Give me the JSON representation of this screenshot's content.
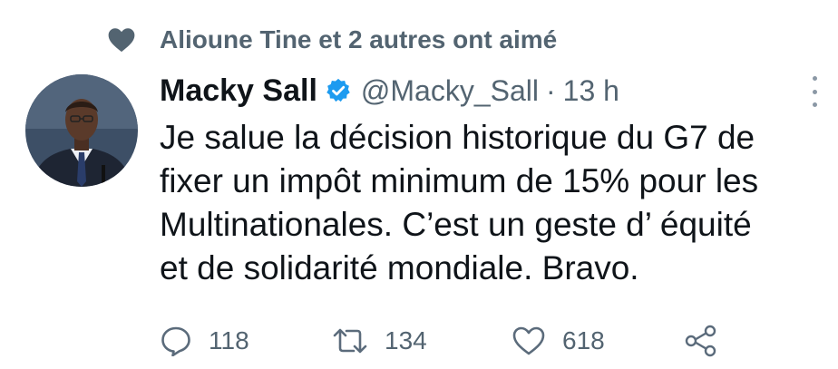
{
  "social_context": {
    "icon": "heart-icon",
    "text": "Alioune Tine et 2 autres ont aimé"
  },
  "tweet": {
    "avatar_icon": "avatar",
    "author_name": "Macky Sall",
    "verified_icon": "verified-badge-icon",
    "handle": "@Macky_Sall",
    "separator": "·",
    "time": "13 h",
    "text_lines": [
      "Je salue la décision historique du G7 de",
      "fixer un impôt minimum de 15% pour les",
      "Multinationales. C’est un geste d’ équité",
      "et de solidarité mondiale. Bravo."
    ]
  },
  "actions": {
    "reply": {
      "icon": "reply-icon",
      "count": "118"
    },
    "retweet": {
      "icon": "retweet-icon",
      "count": "134"
    },
    "like": {
      "icon": "like-icon",
      "count": "618"
    },
    "share": {
      "icon": "share-icon"
    }
  },
  "colors": {
    "text": "#0f1419",
    "secondary": "#536471",
    "verified": "#1d9bf0",
    "icon": "#5b6b7b"
  }
}
